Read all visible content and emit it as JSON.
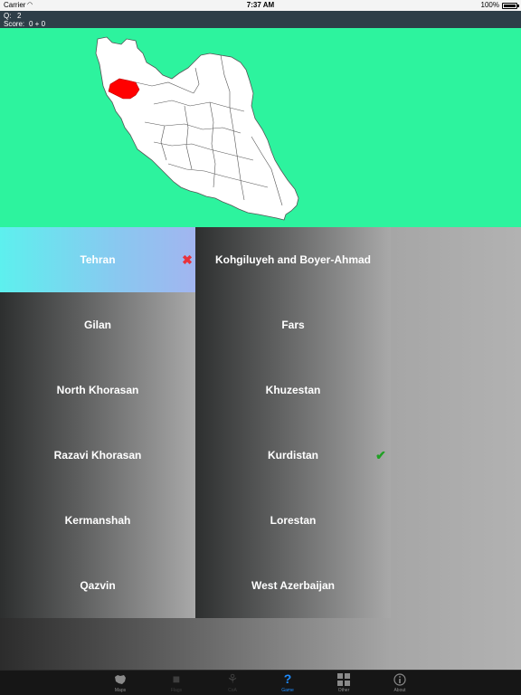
{
  "status_bar": {
    "carrier": "Carrier",
    "time": "7:37 AM",
    "battery": "100%"
  },
  "score": {
    "question_label": "Q:",
    "question_number": "2",
    "score_label": "Score:",
    "score_value": "0 + 0"
  },
  "map": {
    "background_color": "#2df39e",
    "highlight_color": "#ff0000",
    "highlighted_region": "Kurdistan"
  },
  "answers": {
    "left": [
      {
        "label": "Tehran",
        "state": "wrong"
      },
      {
        "label": "Gilan",
        "state": "default"
      },
      {
        "label": "North Khorasan",
        "state": "default"
      },
      {
        "label": "Razavi Khorasan",
        "state": "default"
      },
      {
        "label": "Kermanshah",
        "state": "default"
      },
      {
        "label": "Qazvin",
        "state": "default"
      }
    ],
    "right": [
      {
        "label": "Kohgiluyeh and Boyer-Ahmad",
        "state": "default"
      },
      {
        "label": "Fars",
        "state": "default"
      },
      {
        "label": "Khuzestan",
        "state": "default"
      },
      {
        "label": "Kurdistan",
        "state": "correct"
      },
      {
        "label": "Lorestan",
        "state": "default"
      },
      {
        "label": "West Azerbaijan",
        "state": "default"
      }
    ]
  },
  "tab_bar": {
    "items": [
      {
        "label": "Maps",
        "icon": "map-icon"
      },
      {
        "label": "Flags",
        "icon": "flag-icon"
      },
      {
        "label": "CoA",
        "icon": "emblem-icon"
      },
      {
        "label": "Game",
        "icon": "question-icon"
      },
      {
        "label": "Other",
        "icon": "grid-icon"
      },
      {
        "label": "About",
        "icon": "info-icon"
      }
    ],
    "active": "Game"
  }
}
